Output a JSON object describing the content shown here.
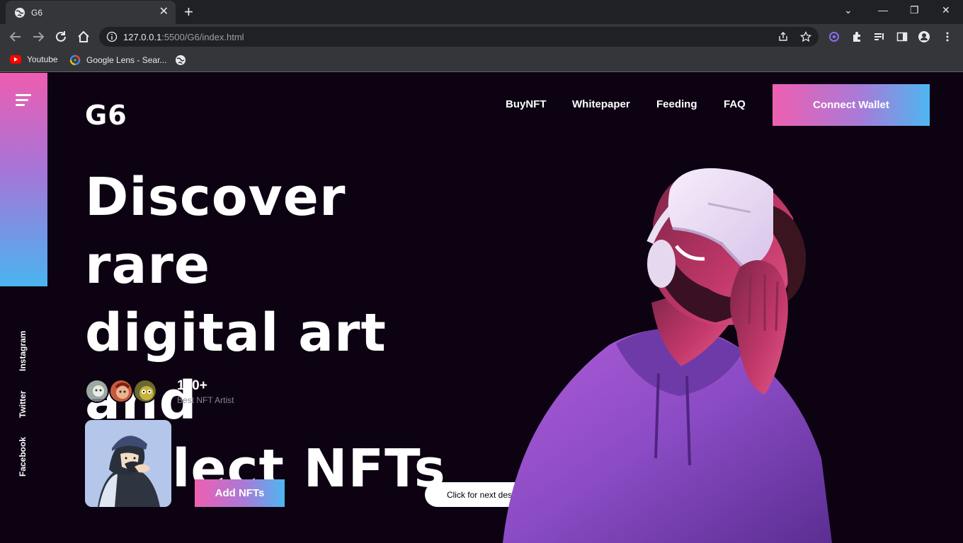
{
  "browser": {
    "tab_title": "G6",
    "url_host": "127.0.0.1",
    "url_rest": ":5500/G6/index.html",
    "bookmarks": [
      "Youtube",
      "Google Lens - Sear..."
    ]
  },
  "site": {
    "logo": "G6",
    "nav": [
      "BuyNFT",
      "Whitepaper",
      "Feeding",
      "FAQ"
    ],
    "connect_label": "Connect Wallet",
    "hero_lines": [
      "Discover rare",
      "digital art and",
      "collect NFTs"
    ],
    "stat_number": "100+",
    "stat_label": "Best NFT Artist",
    "add_label": "Add NFTs",
    "next_label": "Click for next desgin",
    "social": [
      "Instagram",
      "Twitter",
      "Facebook"
    ]
  },
  "colors": {
    "gradient_pink": "#ef5fb1",
    "gradient_blue": "#4eb6f1",
    "page_bg": "#0c0212"
  }
}
